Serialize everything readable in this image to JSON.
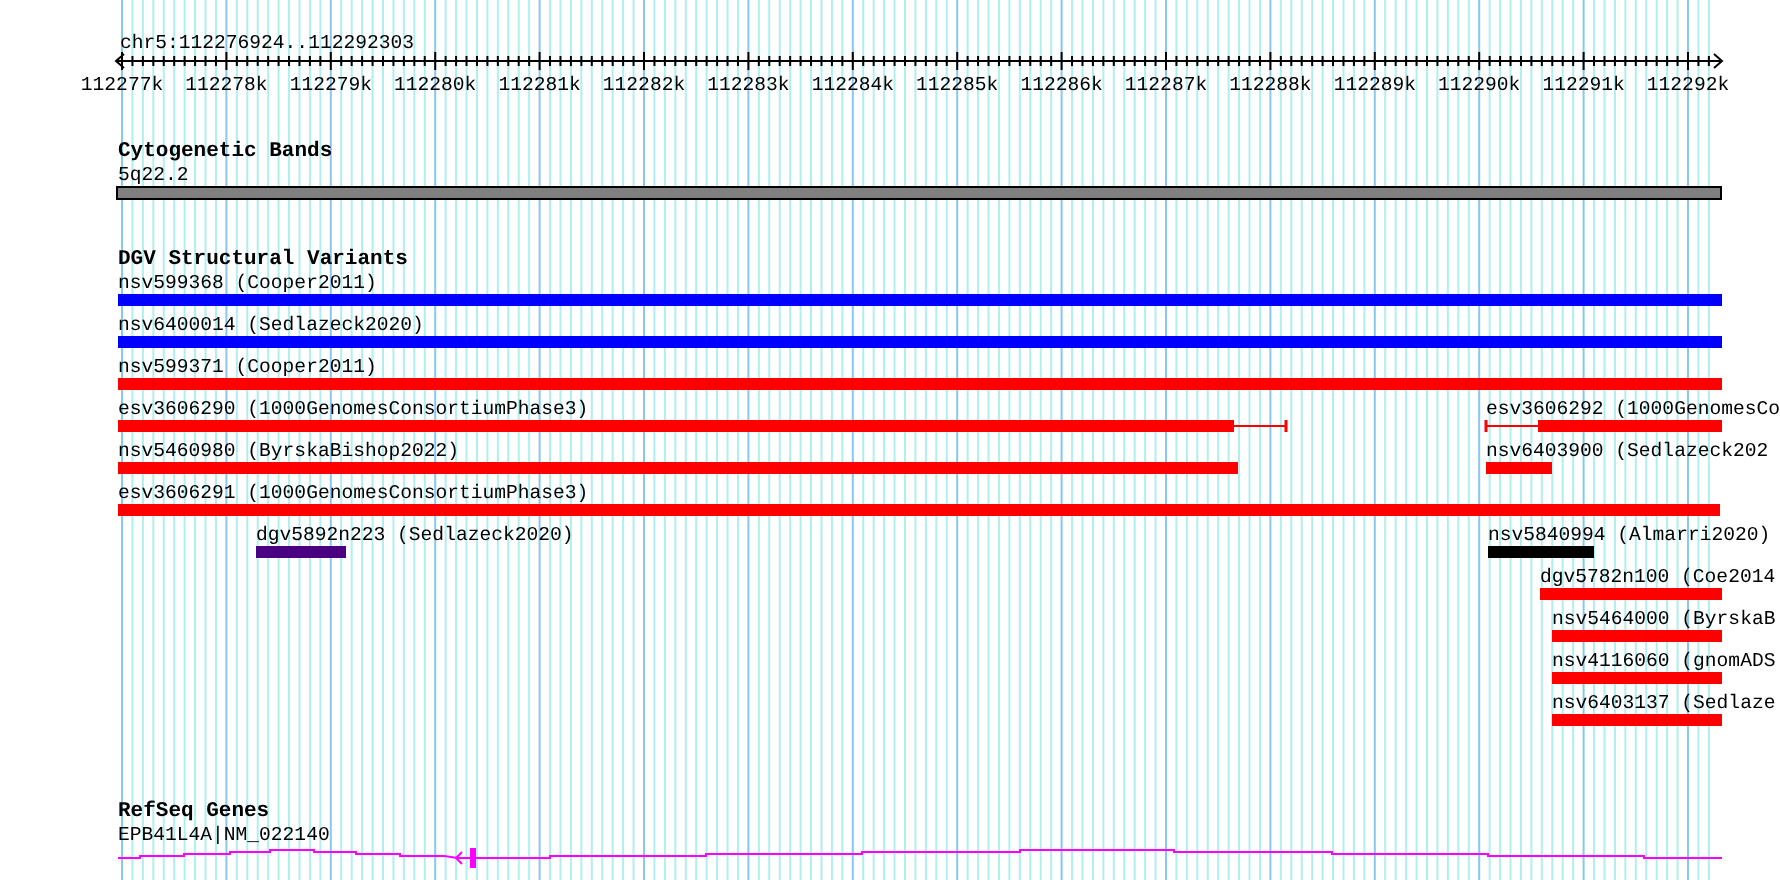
{
  "ruler": {
    "location": "chr5:112276924..112292303",
    "ticks": [
      "112277k",
      "112278k",
      "112279k",
      "112280k",
      "112281k",
      "112282k",
      "112283k",
      "112284k",
      "112285k",
      "112286k",
      "112287k",
      "112288k",
      "112289k",
      "112290k",
      "112291k",
      "112292k"
    ]
  },
  "tracks": [
    {
      "title": "Cytogenetic Bands",
      "features": [
        {
          "label": "5q22.2",
          "kind": "band"
        }
      ]
    },
    {
      "title": "DGV Structural Variants",
      "features": [
        {
          "label": "nsv599368 (Cooper2011)",
          "kind": "bar",
          "color": "#0000ff"
        },
        {
          "label": "nsv6400014 (Sedlazeck2020)",
          "kind": "bar",
          "color": "#0000ff"
        },
        {
          "label": "nsv599371 (Cooper2011)",
          "kind": "bar",
          "color": "#ff0000"
        },
        {
          "label": "esv3606290 (1000GenomesConsortiumPhase3)",
          "kind": "split",
          "color": "#ff0000"
        },
        {
          "label": "esv3606292 (1000GenomesCo",
          "kind": "split",
          "color": "#ff0000"
        },
        {
          "label": "nsv5460980 (ByrskaBishop2022)",
          "kind": "bar",
          "color": "#ff0000"
        },
        {
          "label": "nsv6403900 (Sedlazeck202",
          "kind": "bar",
          "color": "#ff0000"
        },
        {
          "label": "esv3606291 (1000GenomesConsortiumPhase3)",
          "kind": "bar",
          "color": "#ff0000"
        },
        {
          "label": "dgv5892n223 (Sedlazeck2020)",
          "kind": "bar",
          "color": "#4b0082"
        },
        {
          "label": "nsv5840994 (Almarri2020)",
          "kind": "bar",
          "color": "#000000"
        },
        {
          "label": "dgv5782n100 (Coe2014",
          "kind": "bar",
          "color": "#ff0000"
        },
        {
          "label": "nsv5464000 (ByrskaB",
          "kind": "bar",
          "color": "#ff0000"
        },
        {
          "label": "nsv4116060 (gnomADS",
          "kind": "bar",
          "color": "#ff0000"
        },
        {
          "label": "nsv6403137 (Sedlaze",
          "kind": "bar",
          "color": "#ff0000"
        }
      ]
    },
    {
      "title": "RefSeq Genes",
      "features": [
        {
          "label": "EPB41L4A|NM_022140",
          "kind": "gene"
        }
      ]
    }
  ]
}
